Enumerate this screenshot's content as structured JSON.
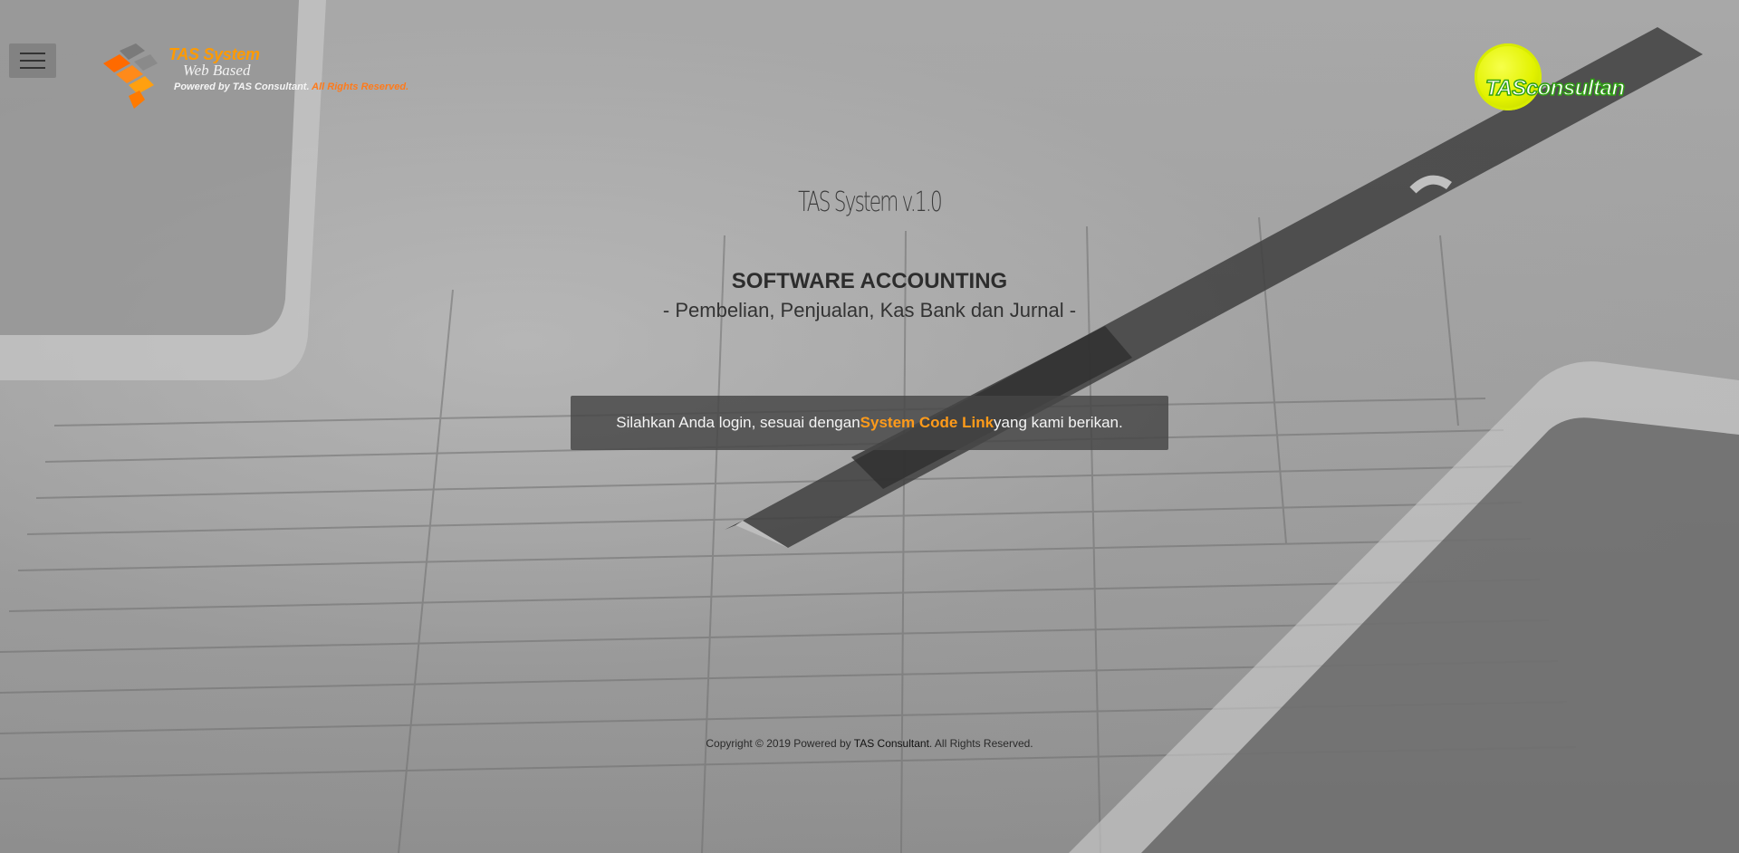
{
  "header": {
    "menu_icon": "hamburger-icon",
    "logo_left": {
      "title": "TAS System",
      "subtitle": "Web Based",
      "powered_prefix": "Powered by TAS Consultant.",
      "powered_suffix": " All Rights Reserved."
    },
    "logo_right": {
      "brand": "TASconsultan"
    }
  },
  "main": {
    "version": "TAS System v.1.0",
    "heading": "SOFTWARE ACCOUNTING",
    "subheading": "- Pembelian, Penjualan, Kas Bank dan Jurnal -",
    "notice": {
      "prefix": "Silahkan Anda login, sesuai dengan ",
      "link": "System Code Link",
      "suffix": " yang kami berikan."
    }
  },
  "footer": {
    "prefix": "Copyright © 2019 Powered by ",
    "brand": "TAS Consultant",
    "suffix": ". All Rights Reserved."
  },
  "colors": {
    "accent_orange": "#ff9b1a",
    "logo_green": "#2ea012",
    "logo_yellow": "#e2f200"
  }
}
